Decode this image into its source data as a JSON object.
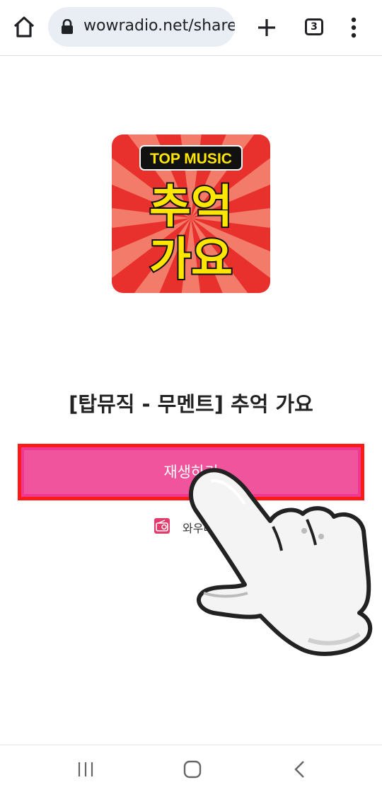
{
  "browser": {
    "url": "wowradio.net/share/",
    "tab_count": "3"
  },
  "album_art": {
    "badge_text": "TOP MUSIC",
    "line1": "추억",
    "line2": "가요"
  },
  "main": {
    "title": "[탑뮤직 - 무멘트] 추억 가요",
    "play_label": "재생하기",
    "provider_label": "와우라디오"
  },
  "icons": {
    "home": "home-icon",
    "lock": "lock-icon",
    "add": "plus-icon",
    "tabs": "tab-switcher-icon",
    "menu": "more-vert-icon",
    "provider": "radio-icon",
    "pointer": "pointing-hand-icon",
    "nav_recents": "recents-icon",
    "nav_home": "nav-home-icon",
    "nav_back": "back-icon"
  },
  "colors": {
    "play_button": "#ef549c",
    "highlight_border": "#ff1a1a",
    "album_red": "#e8312c"
  }
}
